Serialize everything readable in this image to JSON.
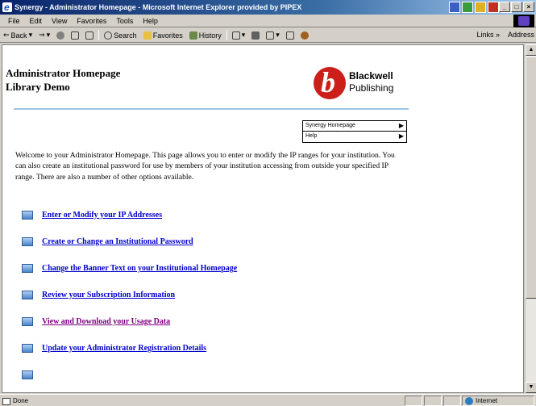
{
  "window": {
    "title": "Synergy - Administrator Homepage - Microsoft Internet Explorer provided by PIPEX"
  },
  "menubar": {
    "items": [
      "File",
      "Edit",
      "View",
      "Favorites",
      "Tools",
      "Help"
    ]
  },
  "toolbar": {
    "back": "Back",
    "search": "Search",
    "favorites": "Favorites",
    "history": "History",
    "links": "Links",
    "address": "Address"
  },
  "page": {
    "title_line1": "Administrator Homepage",
    "title_line2": "Library Demo",
    "logo_line1": "Blackwell",
    "logo_line2": "Publishing",
    "quickmenu": [
      {
        "label": "Synergy Homepage"
      },
      {
        "label": "Help"
      }
    ],
    "intro": "Welcome to your Administrator Homepage.  This page allows you to enter or modify the IP ranges for your institution.  You can also create an institutional password for use by members of your institution accessing from outside your specified IP range.  There are also a number of other options available.",
    "links": [
      {
        "label": "Enter or Modify your IP Addresses",
        "visited": false
      },
      {
        "label": "Create or Change an Institutional Password",
        "visited": false
      },
      {
        "label": "Change the Banner Text on your Institutional Homepage",
        "visited": false
      },
      {
        "label": "Review your Subscription Information",
        "visited": false
      },
      {
        "label": "View and Download your Usage Data",
        "visited": true
      },
      {
        "label": "Update your Administrator Registration Details",
        "visited": false
      }
    ]
  },
  "statusbar": {
    "status": "Done",
    "zone": "Internet"
  },
  "colors": {
    "link": "#0000cc",
    "visited": "#800080",
    "logo_red": "#cc1f1a",
    "divider": "#9cc3e6"
  }
}
